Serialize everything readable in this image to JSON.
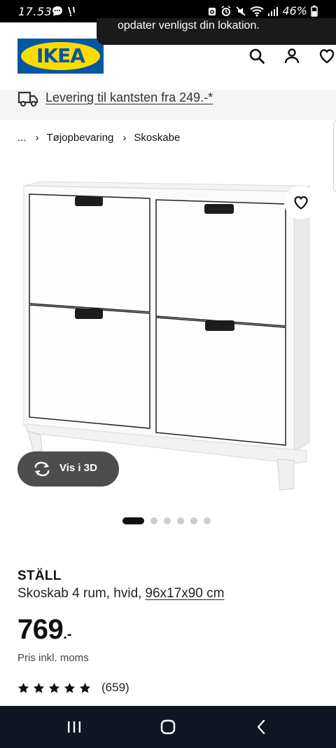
{
  "status_bar": {
    "time": "17.53",
    "battery": "46%",
    "left_icons": [
      "chat-bubble-icon",
      "notification-icon"
    ],
    "right_icons": [
      "alarm-icon",
      "vibrate-icon",
      "mute-icon",
      "wifi-icon",
      "signal-icon",
      "battery-icon"
    ]
  },
  "toast": {
    "text": "opdater venligst din lokation."
  },
  "header": {
    "logo_text": "IKEA",
    "icons": [
      "search-icon",
      "account-icon",
      "heart-icon"
    ]
  },
  "delivery": {
    "text": "Levering til kantsten fra 249.-*"
  },
  "breadcrumb": {
    "items": [
      "...",
      "Tøjopbevaring",
      "Skoskabe"
    ]
  },
  "gallery": {
    "view3d_label": "Vis i 3D",
    "dots_total": 6,
    "active_index": 0
  },
  "product": {
    "name": "STÄLL",
    "description": "Skoskab 4 rum, hvid,",
    "dimensions": "96x17x90 cm",
    "price_integer": "769",
    "price_suffix": ".-",
    "price_note": "Pris inkl. moms",
    "rating_stars": 5,
    "rating_count": "(659)"
  },
  "nav_bar": {
    "buttons": [
      "recent-apps-icon",
      "home-icon",
      "back-icon"
    ]
  },
  "colors": {
    "ikea_blue": "#0058a3",
    "ikea_yellow": "#ffdb00",
    "nav_bg": "#101722"
  }
}
